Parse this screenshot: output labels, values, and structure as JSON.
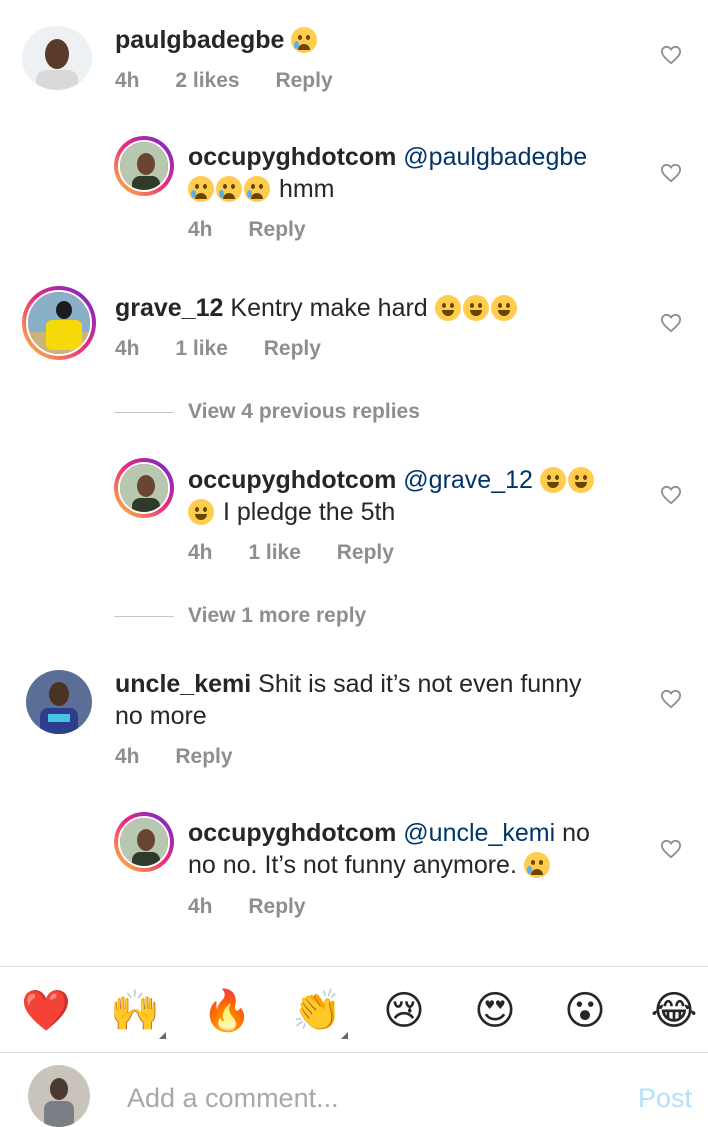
{
  "comments": [
    {
      "username": "paulgbadegbe",
      "text": "",
      "time": "4h",
      "likes": "2 likes",
      "reply": "Reply"
    },
    {
      "username": "occupyghdotcom",
      "mention": "@paulgbadegbe",
      "text": "hmm",
      "time": "4h",
      "reply": "Reply"
    },
    {
      "username": "grave_12",
      "text": "Kentry make hard",
      "time": "4h",
      "likes": "1 like",
      "reply": "Reply"
    },
    {
      "username": "occupyghdotcom",
      "mention": "@grave_12",
      "text": "I pledge the 5th",
      "time": "4h",
      "likes": "1 like",
      "reply": "Reply"
    },
    {
      "username": "uncle_kemi",
      "text_line1": "Shit is sad it’s not even funny",
      "text_line2": "no more",
      "time": "4h",
      "reply": "Reply"
    },
    {
      "username": "occupyghdotcom",
      "mention": "@uncle_kemi",
      "text_tail1": "no",
      "text_line2": "no no. It’s not funny anymore.",
      "time": "4h",
      "reply": "Reply"
    }
  ],
  "view_more": [
    "View 4 previous replies",
    "View 1 more reply"
  ],
  "reactions": [
    "❤️",
    "🙌",
    "🔥",
    "👏",
    "😢",
    "😍",
    "😮",
    "😂"
  ],
  "composer": {
    "placeholder": "Add a comment...",
    "post": "Post"
  },
  "colors": {
    "mention": "#003569",
    "meta": "#8e8e8e",
    "post": "#b2dffc"
  }
}
